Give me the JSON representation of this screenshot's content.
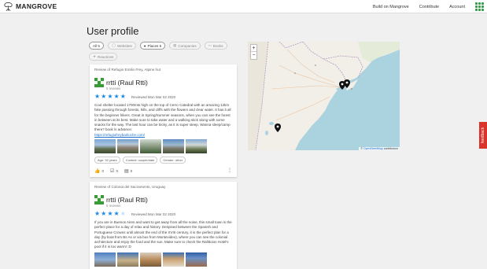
{
  "app": {
    "title": "MANGROVE",
    "nav": [
      "Build on Mangrove",
      "Contribute",
      "Account"
    ]
  },
  "page": {
    "title": "User profile"
  },
  "filters": [
    {
      "label": "All 5",
      "icon": "",
      "active": true
    },
    {
      "label": "Websites",
      "icon": "globe-icon",
      "active": false
    },
    {
      "label": "Places 5",
      "icon": "pin-icon",
      "active": true
    },
    {
      "label": "Companies",
      "icon": "building-icon",
      "active": false
    },
    {
      "label": "Books",
      "icon": "book-icon",
      "active": false
    },
    {
      "label": "Reactions",
      "icon": "reaction-icon",
      "active": false
    }
  ],
  "reviews": [
    {
      "title": "Review of Refugio Emilio Frey, Alpine hut",
      "user": "rrtti (Raul Rtti)",
      "user_reviews": "5 reviews",
      "stars": 5,
      "date": "Reviewed Mon Mar 02 2020",
      "text": "Cool shelter located 1700mts high on the top of Cerro Catedral with an amazing 12km hike passing through forests, hills, and cliffs with the flowers and clear water. It has it all for the beginner hikers. Great in Spring/Summer seasons, when you can see the forest in between at its best. Make sure to take water and a walking stick along with some snacks for the way. The last hour can be tricky, as it is super steep. Wanna sleep/camp there? book in advance:",
      "link": "https://refugiofreybariloche.com/",
      "tags": [
        "Age: 32 years",
        "Context: couple/date",
        "Gender: other"
      ],
      "likes": "0",
      "confirms": "0",
      "reactions": "0"
    },
    {
      "title": "Review of Colonia del Sacramento, Uruguay",
      "user": "rrtti (Raul Rtti)",
      "user_reviews": "5 reviews",
      "stars": 4,
      "date": "Reviewed Mon Mar 02 2020",
      "text": "If you are in Buenos Aires and want to get away from all the noise, this small town is the perfect place for a day of relax and history. Despised between the Spanish and Portuguese Crowns until almost the end of the XVIII century, it is the perfect plan for a day (by boat from Bs As or via bus from Montevideo), where you can see the colonial architecture and enjoy the food and the sun. Make sure to check the Ralittoion Hotel's pool if it is too warm! :D"
    }
  ],
  "map": {
    "zoom_in": "+",
    "zoom_out": "−",
    "attribution_prefix": "©",
    "attribution_link": "OpenStreetMap",
    "attribution_suffix": "contributors"
  },
  "feedback": "feedback",
  "colors": {
    "accent": "#1e88e5",
    "brand": "#2e9e44",
    "feedback": "#d9332b"
  }
}
